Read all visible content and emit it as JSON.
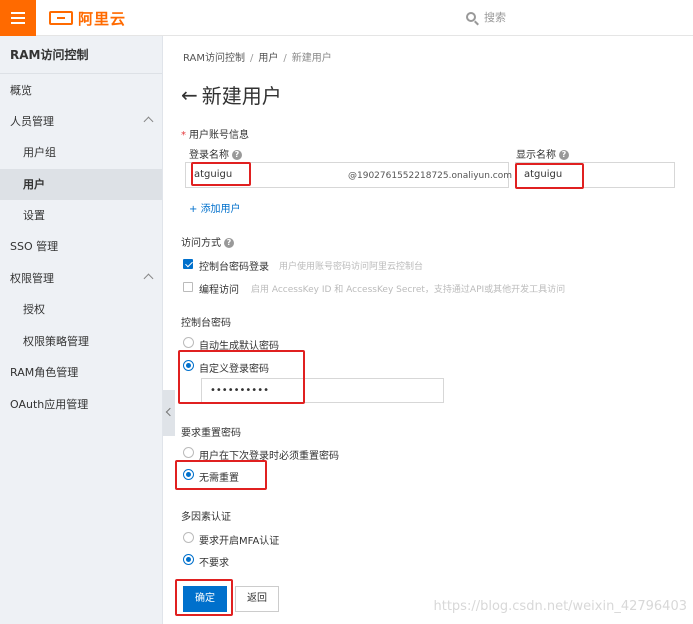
{
  "header": {
    "logo_text": "阿里云",
    "search_placeholder": "搜索",
    "brand_color": "#ff6a00"
  },
  "sidebar": {
    "title": "RAM访问控制",
    "items": [
      {
        "label": "概览"
      },
      {
        "label": "人员管理"
      },
      {
        "label": "用户组"
      },
      {
        "label": "用户"
      },
      {
        "label": "设置"
      },
      {
        "label": "SSO 管理"
      },
      {
        "label": "权限管理"
      },
      {
        "label": "授权"
      },
      {
        "label": "权限策略管理"
      },
      {
        "label": "RAM角色管理"
      },
      {
        "label": "OAuth应用管理"
      }
    ]
  },
  "breadcrumb": {
    "items": [
      "RAM访问控制",
      "用户",
      "新建用户"
    ],
    "separator": "/"
  },
  "page": {
    "title": "新建用户"
  },
  "account": {
    "section_label": "用户账号信息",
    "login_name_label": "登录名称",
    "display_name_label": "显示名称",
    "login_name_value": "atguigu",
    "login_suffix": "@1902761552218725.onaliyun.com",
    "display_name_value": "atguigu",
    "add_user_label": "添加用户"
  },
  "access": {
    "label": "访问方式",
    "console": {
      "label": "控制台密码登录",
      "hint": "用户使用账号密码访问阿里云控制台",
      "checked": true
    },
    "programmatic": {
      "label": "编程访问",
      "hint": "启用 AccessKey ID 和 AccessKey Secret，支持通过API或其他开发工具访问",
      "checked": false
    }
  },
  "console_password": {
    "label": "控制台密码",
    "options": [
      {
        "label": "自动生成默认密码",
        "selected": false
      },
      {
        "label": "自定义登录密码",
        "selected": true
      }
    ],
    "password_value": "••••••••••"
  },
  "reset_password": {
    "label": "要求重置密码",
    "options": [
      {
        "label": "用户在下次登录时必须重置密码",
        "selected": false
      },
      {
        "label": "无需重置",
        "selected": true
      }
    ]
  },
  "mfa": {
    "label": "多因素认证",
    "options": [
      {
        "label": "要求开启MFA认证",
        "selected": false
      },
      {
        "label": "不要求",
        "selected": true
      }
    ]
  },
  "actions": {
    "confirm_label": "确定",
    "back_label": "返回",
    "primary_color": "#0070cc"
  },
  "watermark": "https://blog.csdn.net/weixin_42796403"
}
